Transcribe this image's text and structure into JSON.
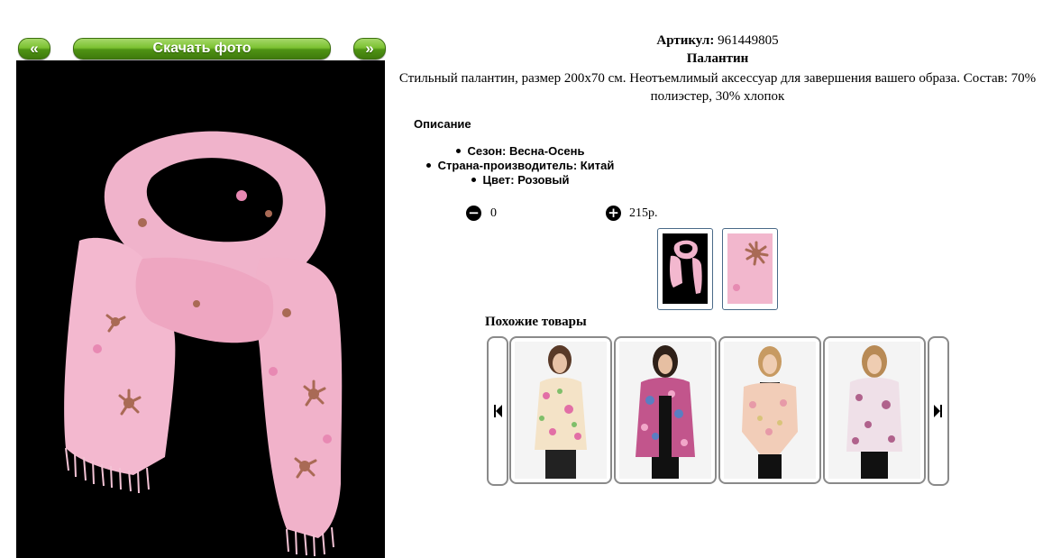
{
  "nav": {
    "prev_label": "«",
    "download_label": "Скачать фото",
    "next_label": "»"
  },
  "product": {
    "article_label": "Артикул:",
    "article_value": "961449805",
    "name": "Палантин",
    "description": "Стильный палантин, размер 200х70 см. Неотъемлимый аксессуар для завершения вашего образа. Состав: 70% полиэстер, 30% хлопок"
  },
  "specs": {
    "heading": "Описание",
    "items": [
      "Сезон: Весна-Осень",
      "Страна-производитель: Китай",
      "Цвет: Розовый"
    ]
  },
  "order": {
    "quantity": "0",
    "price": "215р."
  },
  "similar": {
    "heading": "Похожие товары"
  },
  "icons": {
    "minus": "minus-circle-icon",
    "plus": "plus-circle-icon",
    "carousel_prev": "skip-back-icon",
    "carousel_next": "skip-forward-icon"
  },
  "colors": {
    "button_green": "#5fa81f",
    "scarf_pink": "#f2b4cc",
    "thumb_border": "#4a6a88"
  }
}
